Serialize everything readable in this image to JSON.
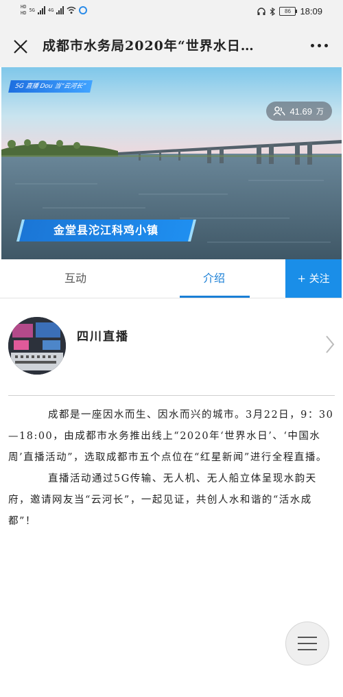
{
  "status_bar": {
    "sim1": "HD",
    "sim2": "HD",
    "net1": "5G",
    "net2": "4G",
    "battery": "86",
    "time": "18:09"
  },
  "title_bar": {
    "title": "成都市水务局2020年“世界水日…"
  },
  "video": {
    "brand_tag": "5G 直播 Dou 当“云河长”",
    "viewer_count": "41.69",
    "viewer_unit": "万",
    "location_banner": "金堂县沱江科鸡小镇"
  },
  "tabs": {
    "interact": "互动",
    "intro": "介绍",
    "follow": "+ 关注",
    "active": "intro"
  },
  "channel": {
    "name": "四川直播"
  },
  "description": {
    "paragraphs": [
      "成都是一座因水而生、因水而兴的城市。3月22日，9：30—18:00，由成都市水务推出线上“2020年‘世界水日’、‘中国水周’直播活动”，选取成都市五个点位在“红星新闻”进行全程直播。",
      "直播活动通过5G传输、无人机、无人船立体呈现水韵天府，邀请网友当“云河长”，一起见证，共创人水和谐的“活水成都”！"
    ]
  },
  "colors": {
    "accent": "#1a8ee8",
    "tab_active": "#1a7fd6"
  },
  "icons": [
    "close-icon",
    "more-icon",
    "viewers-icon",
    "chevron-right-icon",
    "menu-icon"
  ]
}
